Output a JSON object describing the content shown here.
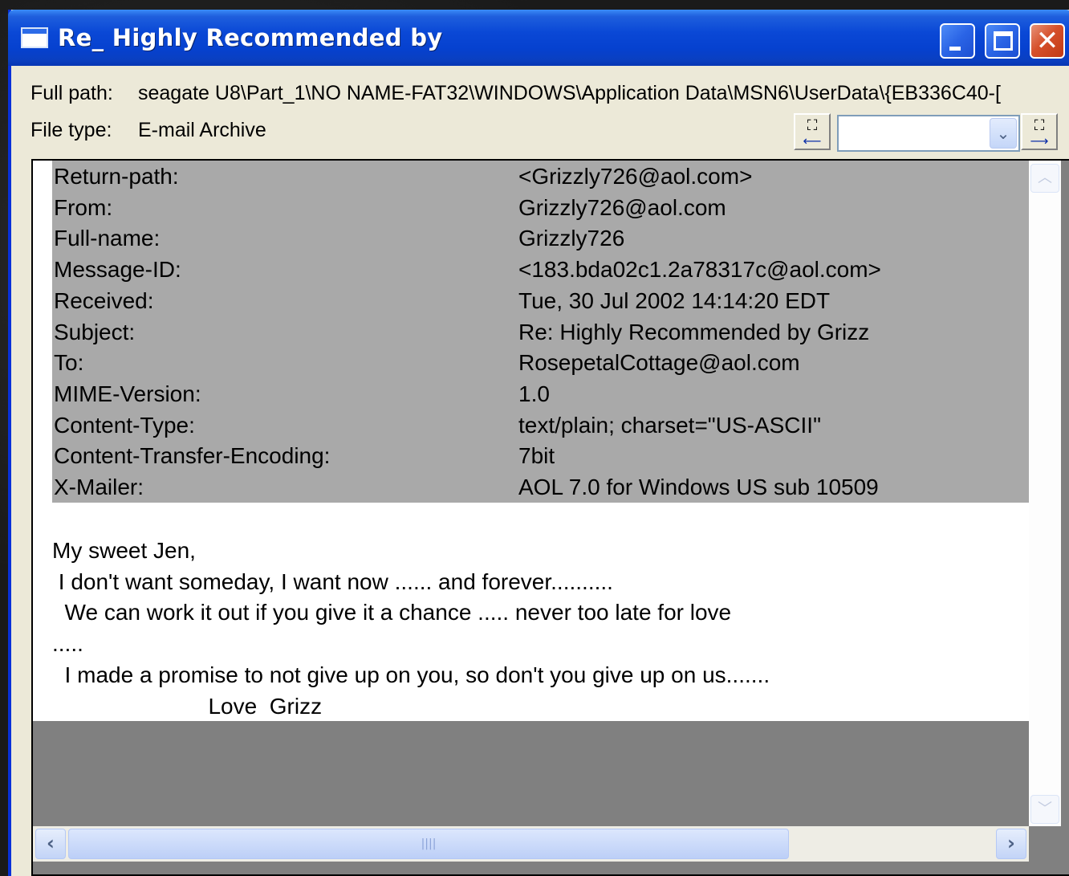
{
  "window": {
    "title": "Re_ Highly Recommended by",
    "minimize_label": "_",
    "maximize_label": "□",
    "close_label": "✕"
  },
  "meta": {
    "path_label": "Full path:",
    "path_value": "seagate U8\\Part_1\\NO NAME-FAT32\\WINDOWS\\Application Data\\MSN6\\UserData\\{EB336C40-[",
    "type_label": "File type:",
    "type_value": "E-mail Archive"
  },
  "find": {
    "prev_icon": "binoculars-prev-icon",
    "next_icon": "binoculars-next-icon",
    "query": "",
    "dropdown_icon": "chevron-down-icon"
  },
  "headers": [
    {
      "key": "Return-path:",
      "value": "<Grizzly726@aol.com>"
    },
    {
      "key": "From:",
      "value": "Grizzly726@aol.com"
    },
    {
      "key": "Full-name:",
      "value": "Grizzly726"
    },
    {
      "key": "Message-ID:",
      "value": "<183.bda02c1.2a78317c@aol.com>"
    },
    {
      "key": "Received:",
      "value": "Tue, 30 Jul 2002 14:14:20 EDT"
    },
    {
      "key": "Subject:",
      "value": "Re: Highly Recommended by Grizz"
    },
    {
      "key": "To:",
      "value": "RosepetalCottage@aol.com"
    },
    {
      "key": "MIME-Version:",
      "value": "1.0"
    },
    {
      "key": "Content-Type:",
      "value": "text/plain; charset=\"US-ASCII\""
    },
    {
      "key": "Content-Transfer-Encoding:",
      "value": "7bit"
    },
    {
      "key": "X-Mailer:",
      "value": "AOL 7.0 for Windows US sub 10509"
    }
  ],
  "body": [
    "My sweet Jen,",
    " I don't want someday, I want now ...... and forever..........",
    "  We can work it out if you give it a chance ..... never too late for love",
    ".....",
    "  I made a promise to not give up on you, so don't you give up on us.......",
    "                         Love  Grizz"
  ],
  "scrollbars": {
    "up_icon": "scroll-up-icon",
    "down_icon": "scroll-down-icon",
    "left_icon": "scroll-left-icon",
    "right_icon": "scroll-right-icon",
    "thumb_grip": "||||"
  }
}
